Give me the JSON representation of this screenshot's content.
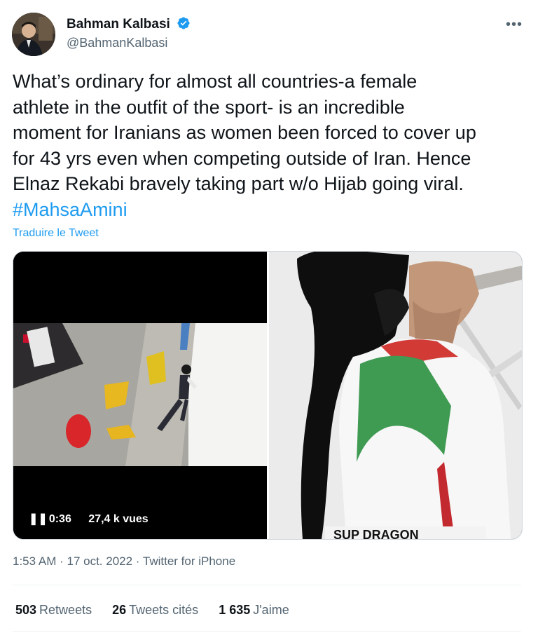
{
  "author": {
    "name": "Bahman Kalbasi",
    "handle": "@BahmanKalbasi",
    "verified": true
  },
  "more_icon": "more-horizontal-icon",
  "tweet": {
    "lines": [
      "What’s ordinary for almost all countries-a female",
      "athlete in the outfit of the sport- is an incredible",
      "moment for Iranians as women been forced to cover up",
      "for 43 yrs even when competing outside of Iran. Hence",
      "Elnaz Rekabi bravely taking part w/o Hijab going viral."
    ],
    "hashtag": "#MahsaAmini",
    "translate_label": "Traduire le Tweet"
  },
  "media": {
    "video_duration": "0:36",
    "video_views": "27,4 k vues",
    "pause_icon": "pause-icon"
  },
  "meta": {
    "time": "1:53 AM",
    "separator1": " · ",
    "date": "17 oct. 2022",
    "separator2": " · ",
    "source": "Twitter for iPhone"
  },
  "stats": {
    "retweets_count": "503",
    "retweets_label": "Retweets",
    "quotes_count": "26",
    "quotes_label": "Tweets cités",
    "likes_count": "1 635",
    "likes_label": "J'aime"
  },
  "colors": {
    "accent": "#1d9bf0",
    "text": "#0f1419",
    "secondary": "#536471"
  }
}
